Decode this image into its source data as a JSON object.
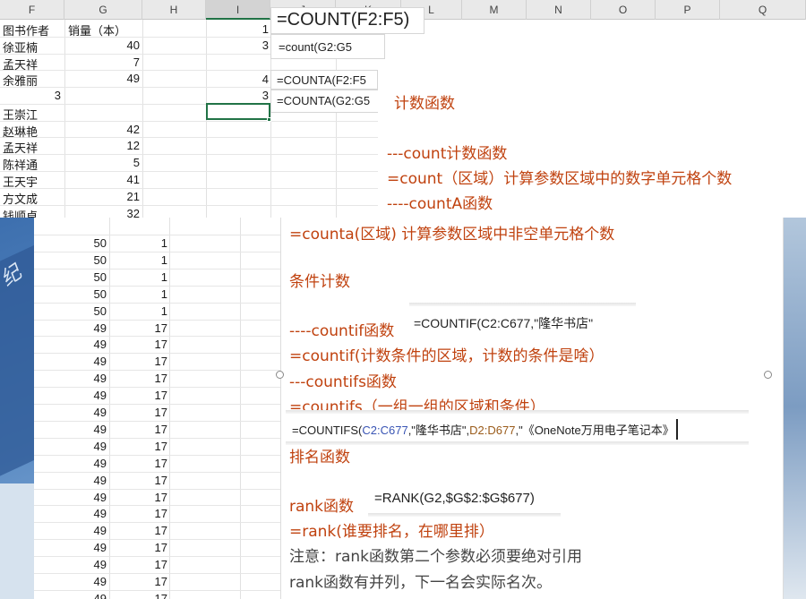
{
  "columns": {
    "F": "F",
    "G": "G",
    "H": "H",
    "I": "I",
    "J": "J",
    "K": "K",
    "L": "L",
    "M": "M",
    "N": "N",
    "O": "O",
    "P": "P",
    "Q": "Q"
  },
  "sheet_top": {
    "headers": {
      "author": "图书作者",
      "sales": "销量（本）"
    },
    "rows": [
      {
        "author": "徐亚楠",
        "sales": "40",
        "i": "1"
      },
      {
        "author": "孟天祥",
        "sales": "7",
        "i": "3"
      },
      {
        "author": "余雅丽",
        "sales": "49",
        "i": ""
      },
      {
        "author": "",
        "sales": "",
        "f_num": "3",
        "i": "4"
      },
      {
        "author": "王崇江",
        "sales": "",
        "i": "3"
      },
      {
        "author": "赵琳艳",
        "sales": "42"
      },
      {
        "author": "孟天祥",
        "sales": "12"
      },
      {
        "author": "陈祥通",
        "sales": "5"
      },
      {
        "author": "王天宇",
        "sales": "41"
      },
      {
        "author": "方文成",
        "sales": "21"
      },
      {
        "author": "钱顺卓",
        "sales": "32"
      }
    ]
  },
  "formula_overlays": {
    "count_big": "=COUNT(F2:F5)",
    "count_small": "=count(G2:G5",
    "counta_1": "=COUNTA(F2:F5",
    "counta_2": "=COUNTA(G2:G5"
  },
  "notes_top": {
    "title": "计数函数",
    "count_heading": "---count计数函数",
    "count_syntax": "=count（区域）计算参数区域中的数字单元格个数",
    "counta_heading": "----countA函数"
  },
  "sheet_bottom": {
    "rows": [
      {
        "g": "50",
        "h": "1"
      },
      {
        "g": "50",
        "h": "1"
      },
      {
        "g": "50",
        "h": "1"
      },
      {
        "g": "50",
        "h": "1"
      },
      {
        "g": "50",
        "h": "1"
      },
      {
        "g": "49",
        "h": "17"
      },
      {
        "g": "49",
        "h": "17"
      },
      {
        "g": "49",
        "h": "17"
      },
      {
        "g": "49",
        "h": "17"
      },
      {
        "g": "49",
        "h": "17"
      },
      {
        "g": "49",
        "h": "17"
      },
      {
        "g": "49",
        "h": "17"
      },
      {
        "g": "49",
        "h": "17"
      },
      {
        "g": "49",
        "h": "17"
      },
      {
        "g": "49",
        "h": "17"
      },
      {
        "g": "49",
        "h": "17"
      },
      {
        "g": "49",
        "h": "17"
      },
      {
        "g": "49",
        "h": "17"
      },
      {
        "g": "49",
        "h": "17"
      },
      {
        "g": "49",
        "h": "17"
      },
      {
        "g": "49",
        "h": "17"
      },
      {
        "g": "49",
        "h": "17"
      }
    ]
  },
  "onenote": {
    "counta_syntax": "=counta(区域) 计算参数区域中非空单元格个数",
    "cond_title": "条件计数",
    "countif_heading": "----countif函数",
    "countif_example": "=COUNTIF(C2:C677,\"隆华书店\"",
    "countif_syntax": "=countif(计数条件的区域，计数的条件是啥）",
    "countifs_heading": "---countifs函数",
    "countifs_syntax": "=countifs（一组一组的区域和条件）",
    "countifs_example": {
      "p1": "=COUNTIFS(",
      "p2": "C2:C677",
      "p3": ",\"隆华书店\",",
      "p4": "D2:D677",
      "p5": ",\"《OneNote万用电子笔记本》"
    },
    "rank_title": "排名函数",
    "rank_heading": "rank函数",
    "rank_example": "=RANK(G2,$G$2:$G$677)",
    "rank_syntax": "=rank(谁要排名，在哪里排）",
    "note1": "注意：rank函数第二个参数必须要绝对引用",
    "note2": "rank函数有并列，下一名会实际名次。"
  },
  "wallpaper_text": "纪"
}
